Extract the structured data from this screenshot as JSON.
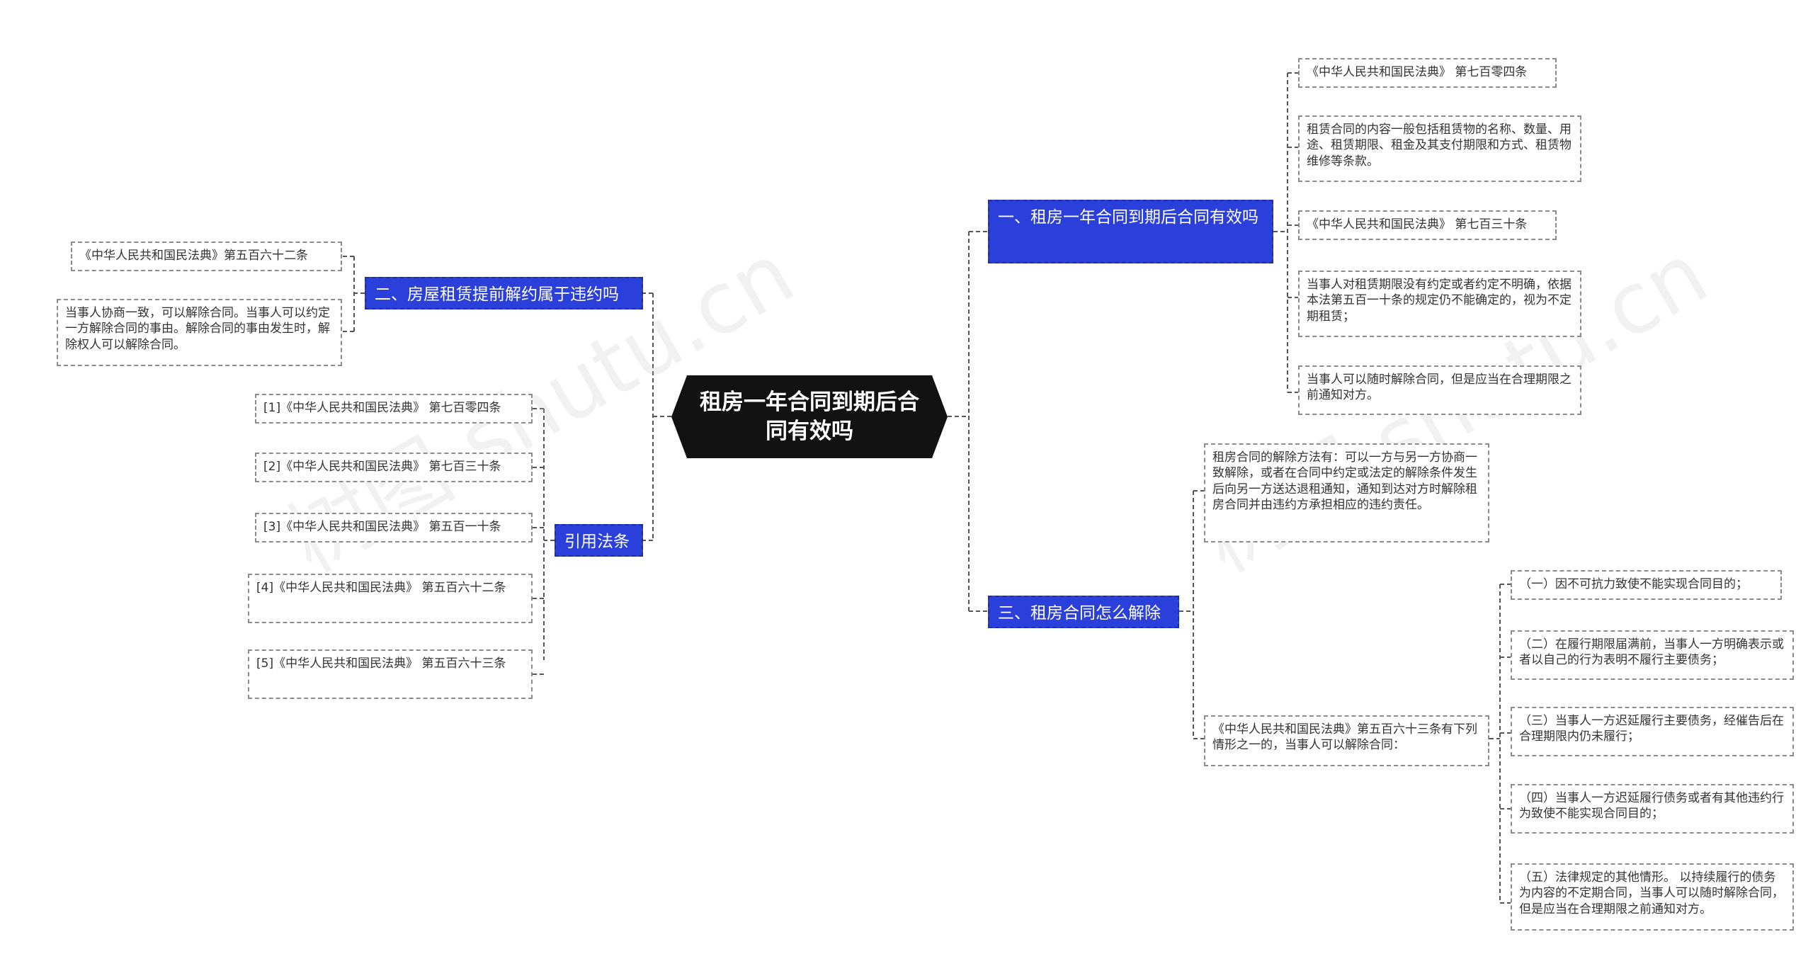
{
  "root": {
    "title": "租房一年合同到期后合同有效吗"
  },
  "branches": {
    "b1": {
      "label": "一、租房一年合同到期后合同有效吗"
    },
    "b2": {
      "label": "二、房屋租赁提前解约属于违约吗"
    },
    "b3": {
      "label": "三、租房合同怎么解除"
    },
    "b4": {
      "label": "引用法条"
    }
  },
  "leaves": {
    "r1a": "《中华人民共和国民法典》 第七百零四条",
    "r1b": "租赁合同的内容一般包括租赁物的名称、数量、用途、租赁期限、租金及其支付期限和方式、租赁物维修等条款。",
    "r1c": "《中华人民共和国民法典》 第七百三十条",
    "r1d": "当事人对租赁期限没有约定或者约定不明确，依据本法第五百一十条的规定仍不能确定的，视为不定期租赁；",
    "r1e": "当事人可以随时解除合同，但是应当在合理期限之前通知对方。",
    "l2a": "《中华人民共和国民法典》第五百六十二条",
    "l2b": "当事人协商一致，可以解除合同。当事人可以约定一方解除合同的事由。解除合同的事由发生时，解除权人可以解除合同。",
    "r3a": "租房合同的解除方法有：可以一方与另一方协商一致解除，或者在合同中约定或法定的解除条件发生后向另一方送达退租通知，通知到达对方时解除租房合同并由违约方承担相应的违约责任。",
    "r3b": "《中华人民共和国民法典》第五百六十三条有下列情形之一的，当事人可以解除合同：",
    "s1": "（一）因不可抗力致使不能实现合同目的；",
    "s2": "（二）在履行期限届满前，当事人一方明确表示或者以自己的行为表明不履行主要债务；",
    "s3": "（三）当事人一方迟延履行主要债务，经催告后在合理期限内仍未履行；",
    "s4": "（四）当事人一方迟延履行债务或者有其他违约行为致使不能实现合同目的；",
    "s5": "（五）法律规定的其他情形。 以持续履行的债务为内容的不定期合同，当事人可以随时解除合同，但是应当在合理期限之前通知对方。",
    "c1": "[1]《中华人民共和国民法典》 第七百零四条",
    "c2": "[2]《中华人民共和国民法典》 第七百三十条",
    "c3": "[3]《中华人民共和国民法典》 第五百一十条",
    "c4": "[4]《中华人民共和国民法典》 第五百六十二条",
    "c5": "[5]《中华人民共和国民法典》 第五百六十三条"
  },
  "watermark": "树图 shutu.cn",
  "colors": {
    "branch_bg": "#2b3fdb",
    "root_bg": "#121212",
    "connector": "#555555",
    "leaf_border": "#8c8c8c"
  }
}
